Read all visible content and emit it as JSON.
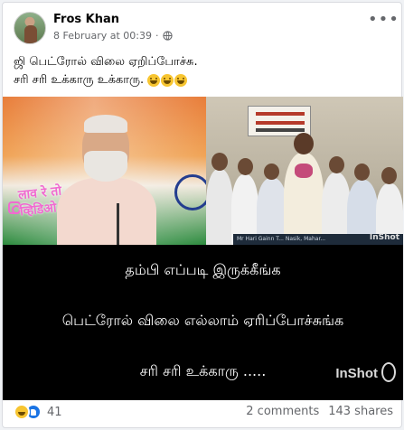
{
  "post": {
    "author": "Fros Khan",
    "timestamp": "8 February at 00:39",
    "separator": "·",
    "privacy_icon": "globe-icon",
    "more_icon": "more-options-icon",
    "text_line1": "ஜி பெட்ரோல் விலை ஏறிப்போச்சு.",
    "text_line2": "சரி சரி உக்காரு உக்காரு.",
    "emoji_count": 3
  },
  "media": {
    "left_watermark_line1": "लाव रे तो",
    "left_watermark_line2": "व्हिडिओ",
    "name_strip": "Mr Hari Gainn  T...  Nasik, Mahar...",
    "inshot_small": "InShot",
    "caption_line1": "தம்பி எப்படி இருக்கீங்க",
    "caption_line2": "பெட்ரோல் விலை எல்லாம் ஏரிப்போச்சுங்க",
    "caption_line3": "சரி சரி உக்காரு .....",
    "inshot_watermark": "InShot"
  },
  "footer": {
    "reaction_icons": [
      "haha-icon",
      "like-icon"
    ],
    "reaction_count": "41",
    "comments": "2 comments",
    "shares": "143 shares"
  },
  "colors": {
    "secondary_text": "#65676b",
    "like_blue": "#1b74e4",
    "caption_bg": "#000000"
  }
}
